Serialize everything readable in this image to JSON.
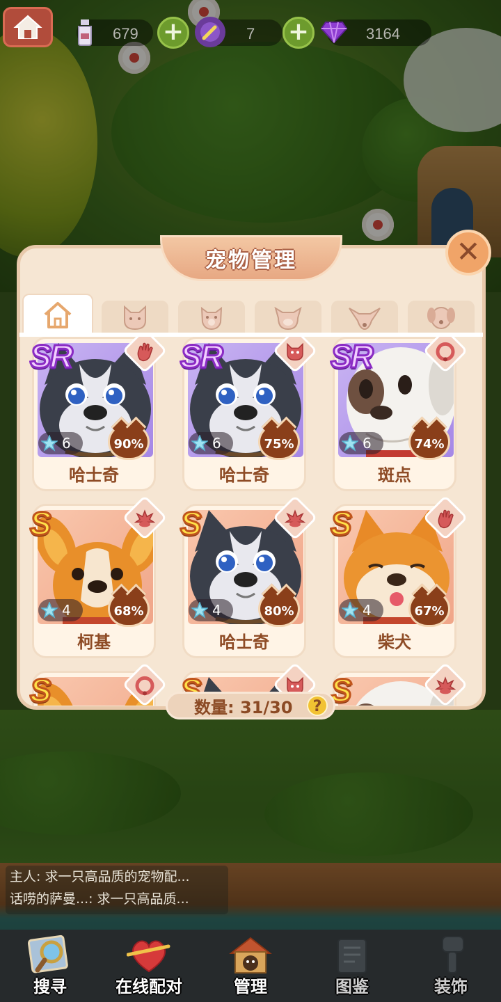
{
  "resources": [
    {
      "icon": "milk-bottle-icon",
      "value": "679"
    },
    {
      "icon": "magic-wand-icon",
      "value": "7"
    },
    {
      "icon": "gem-icon",
      "value": "3164"
    }
  ],
  "panel": {
    "title": "宠物管理",
    "tabs": [
      {
        "icon": "home-icon",
        "active": true
      },
      {
        "icon": "cat-face-icon"
      },
      {
        "icon": "dog-face-icon"
      },
      {
        "icon": "pig-face-icon"
      },
      {
        "icon": "fox-face-icon"
      },
      {
        "icon": "puppy-face-icon"
      }
    ],
    "pets": [
      {
        "rarity": "SR",
        "name": "哈士奇",
        "stars": "6",
        "percent": "90%",
        "trait": "hand-icon",
        "breed": "husky"
      },
      {
        "rarity": "SR",
        "name": "哈士奇",
        "stars": "6",
        "percent": "75%",
        "trait": "cat-face-icon",
        "breed": "husky"
      },
      {
        "rarity": "SR",
        "name": "斑点",
        "stars": "6",
        "percent": "74%",
        "trait": "collar-icon",
        "breed": "spotted"
      },
      {
        "rarity": "S",
        "name": "柯基",
        "stars": "4",
        "percent": "68%",
        "trait": "paw-icon",
        "breed": "corgi"
      },
      {
        "rarity": "S",
        "name": "哈士奇",
        "stars": "4",
        "percent": "80%",
        "trait": "paw-icon",
        "breed": "husky"
      },
      {
        "rarity": "S",
        "name": "柴犬",
        "stars": "4",
        "percent": "67%",
        "trait": "hand-icon",
        "breed": "shiba"
      },
      {
        "rarity": "S",
        "trait": "collar-icon",
        "breed": "corgi"
      },
      {
        "rarity": "S",
        "trait": "cat-face-icon",
        "breed": "husky"
      },
      {
        "rarity": "S",
        "trait": "paw-icon",
        "breed": "spotted"
      }
    ],
    "count_label": "数量: 31/30",
    "help_label": "?"
  },
  "chat": [
    "主人: 求一只高品质的宠物配...",
    "话唠的萨曼...: 求一只高品质..."
  ],
  "nav": [
    {
      "label": "搜寻",
      "icon": "magnifier-icon"
    },
    {
      "label": "在线配对",
      "icon": "heart-arrow-icon"
    },
    {
      "label": "管理",
      "icon": "pet-house-icon"
    },
    {
      "label": "图鉴",
      "icon": "book-icon",
      "disabled": true
    },
    {
      "label": "装饰",
      "icon": "brush-icon",
      "disabled": true
    }
  ],
  "colors": {
    "panel_bg": "#f6e6d3",
    "sr_card_bg": "#b59be9",
    "s_card_bg": "#f5b69b",
    "percent_badge": "#8a3f1a",
    "name_text": "#8e4b25"
  }
}
